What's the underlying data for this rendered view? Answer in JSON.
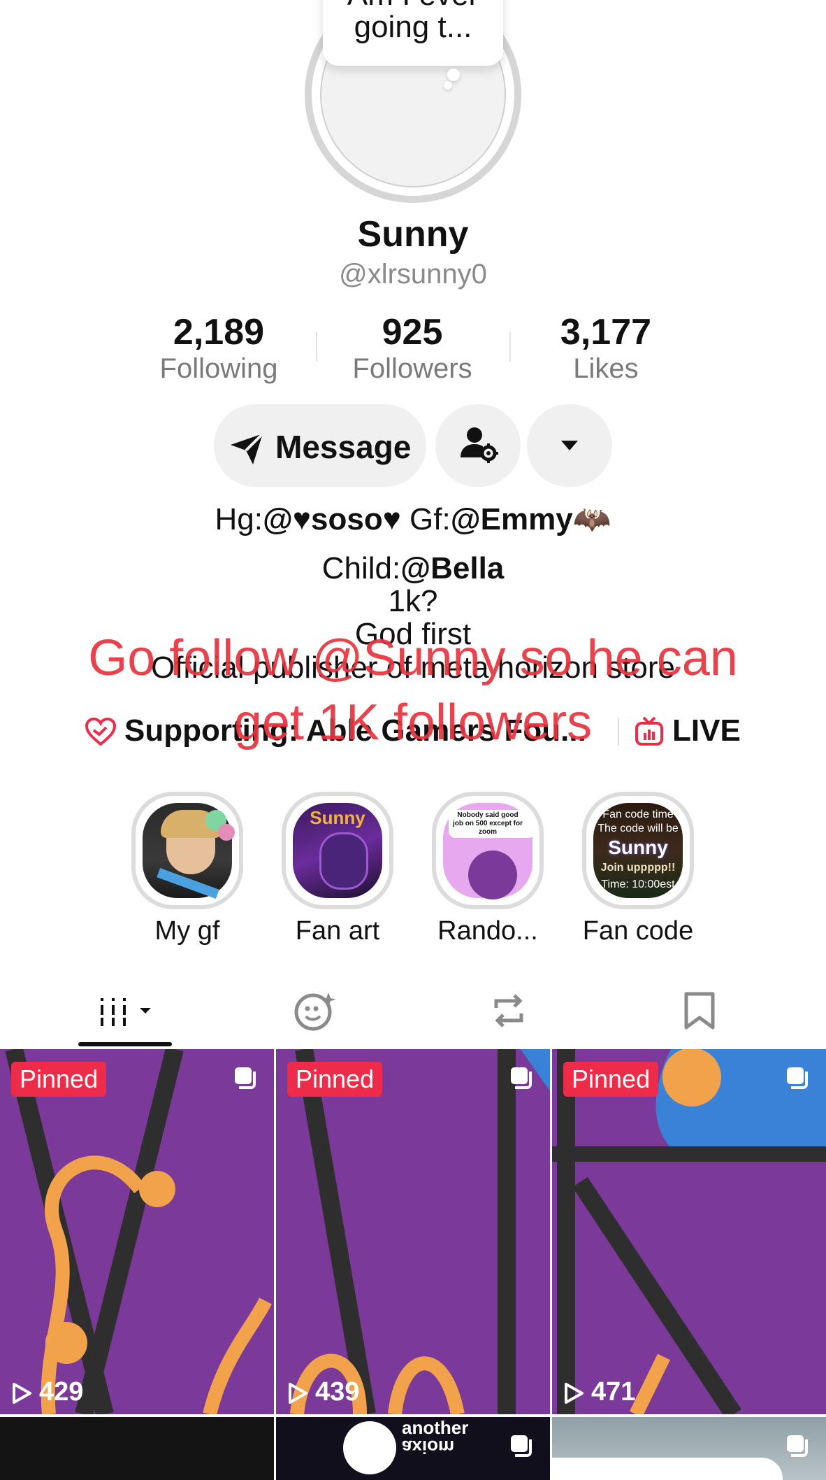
{
  "profile": {
    "note_line1": "Am I ever",
    "note_line2": "going t...",
    "display_name": "Sunny",
    "handle": "@xlrsunny0"
  },
  "stats": {
    "following_count": "2,189",
    "following_label": "Following",
    "followers_count": "925",
    "followers_label": "Followers",
    "likes_count": "3,177",
    "likes_label": "Likes"
  },
  "actions": {
    "message_label": "Message"
  },
  "bio": {
    "line1_hg": "Hg:",
    "line1_hg_mention": "@♥soso♥",
    "line1_gf": " Gf:",
    "line1_gf_mention": "@Emmy",
    "line1_emoji": "🦇",
    "line2_child": "Child:",
    "line2_mention": "@Bella",
    "line3": "1k?",
    "line4": "God first",
    "line5": "Official publisher of meta horizon store"
  },
  "overlay": {
    "line1": "Go follow @Sunny so he can",
    "line2": "get 1K followers"
  },
  "links": {
    "supporting_label": "Supporting: Able Gamers Fou...",
    "live_label": "LIVE"
  },
  "highlights": [
    {
      "label": "My gf"
    },
    {
      "label": "Fan art",
      "thumb_text": "Sunny"
    },
    {
      "label": "Rando...",
      "thumb_text": "Nobody said good job on 500 except for zoom"
    },
    {
      "label": "Fan code",
      "thumb_text_1": "Fan code time",
      "thumb_text_2": "The code will be",
      "thumb_text_3": "Sunny",
      "thumb_text_4": "Join uppppp!!",
      "thumb_text_5": "Time: 10:00est"
    }
  ],
  "grid": {
    "pinned_label": "Pinned",
    "views": [
      "429",
      "439",
      "471"
    ],
    "tile_brand_line1": "another",
    "tile_brand_line2": "axiom"
  },
  "colors": {
    "accent_red": "#ef2b4a",
    "overlay_red": "#e9343f",
    "tile_purple": "#7b3a9a",
    "tile_orange": "#f2a24a"
  }
}
